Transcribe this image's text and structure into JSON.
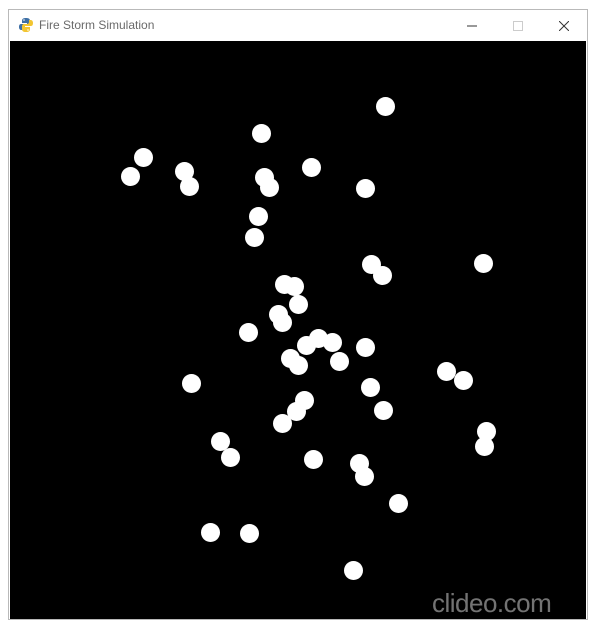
{
  "window": {
    "title": "Fire Storm Simulation",
    "icon": "python-snake-icon"
  },
  "controls": {
    "minimize_icon": "minimize-icon",
    "maximize_icon": "maximize-icon",
    "close_icon": "close-icon"
  },
  "canvas": {
    "background": "#000000",
    "particle_color": "#ffffff"
  },
  "watermark": {
    "text": "clideo.com"
  }
}
